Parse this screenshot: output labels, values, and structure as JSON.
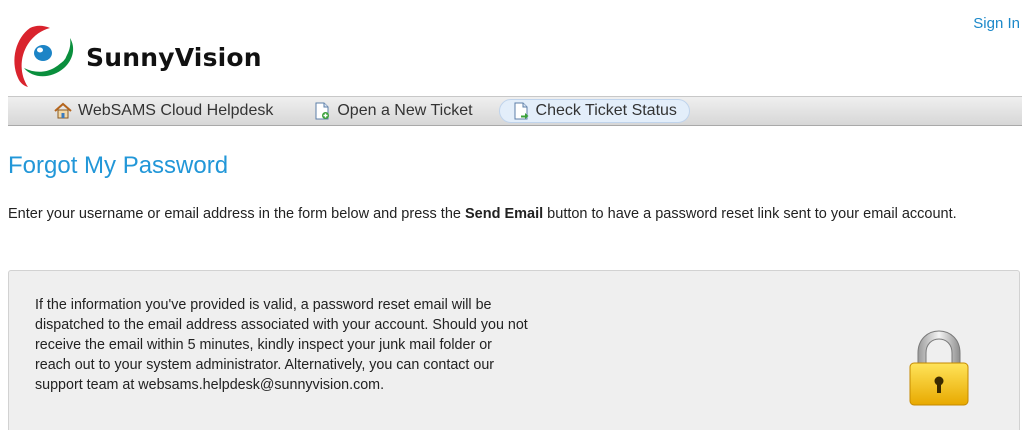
{
  "header": {
    "logo_text": "SunnyVision",
    "signin_label": "Sign In"
  },
  "nav": {
    "items": [
      {
        "label": "WebSAMS Cloud Helpdesk",
        "icon": "home-icon"
      },
      {
        "label": "Open a New Ticket",
        "icon": "new-ticket-icon"
      },
      {
        "label": "Check Ticket Status",
        "icon": "ticket-status-icon"
      }
    ]
  },
  "page": {
    "title": "Forgot My Password",
    "intro_before": "Enter your username or email address in the form below and press the ",
    "intro_bold": "Send Email",
    "intro_after": " button to have a password reset link sent to your email account."
  },
  "panel": {
    "message": "If the information you've provided is valid, a password reset email will be dispatched to the email address associated with your account. Should you not receive the email within 5 minutes, kindly inspect your junk mail folder or reach out to your system administrator. Alternatively, you can contact our support team at websams.helpdesk@sunnyvision.com."
  },
  "colors": {
    "accent": "#2297d8",
    "link": "#1b88c9",
    "lock": "#f2c200"
  }
}
